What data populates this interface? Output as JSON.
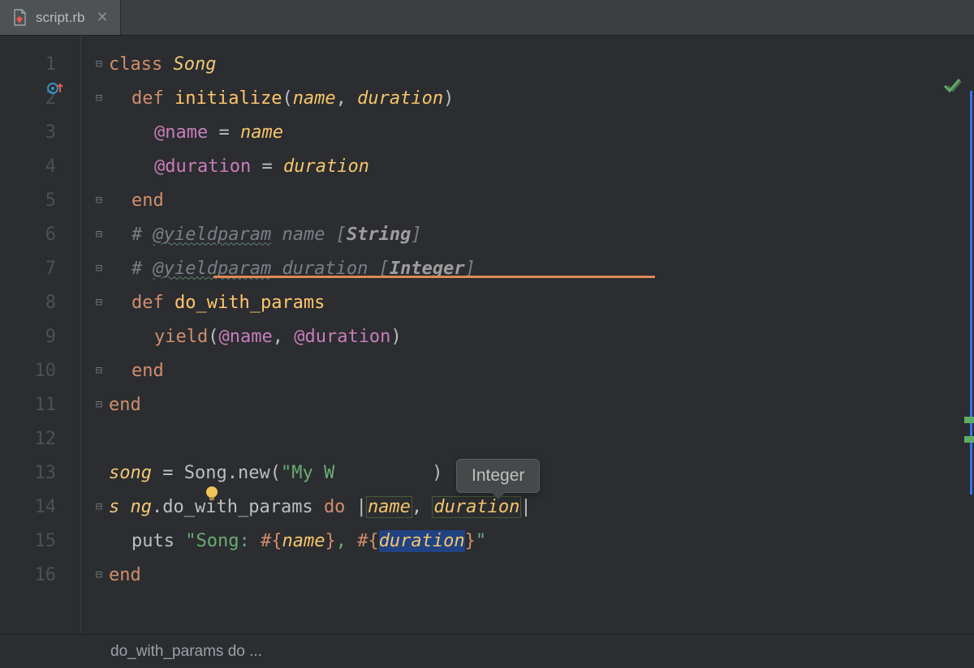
{
  "tab": {
    "filename": "script.rb"
  },
  "tooltip": {
    "text": "Integer"
  },
  "breadcrumb": {
    "text": "do_with_params do ..."
  },
  "gutter": [
    "1",
    "2",
    "3",
    "4",
    "5",
    "6",
    "7",
    "8",
    "9",
    "10",
    "11",
    "12",
    "13",
    "14",
    "15",
    "16"
  ],
  "code": {
    "l1": {
      "kw": "class ",
      "cls": "Song"
    },
    "l2": {
      "kw": "def ",
      "m": "initialize",
      "p1": "name",
      "c": ", ",
      "p2": "duration"
    },
    "l3": {
      "ivar": "@name",
      "op": " = ",
      "p": "name"
    },
    "l4": {
      "ivar": "@duration",
      "op": " = ",
      "p": "duration"
    },
    "l5": {
      "kw": "end"
    },
    "l6": {
      "h": "# ",
      "tag": "@yieldparam",
      "sp": " ",
      "n": "name",
      "br": " [",
      "t": "String",
      "br2": "]"
    },
    "l7": {
      "h": "# ",
      "tag": "@yieldparam",
      "sp": " ",
      "n": "duration",
      "br": " [",
      "t": "Integer",
      "br2": "]"
    },
    "l8": {
      "kw": "def ",
      "m": "do_with_params"
    },
    "l9": {
      "y": "yield",
      "o": "(",
      "v1": "@name",
      "c": ", ",
      "v2": "@duration",
      "cl": ")"
    },
    "l10": {
      "kw": "end"
    },
    "l11": {
      "kw": "end"
    },
    "l13": {
      "v": "song",
      "eq": " = ",
      "c": "Song",
      "d": ".",
      "m": "new",
      "o": "(",
      "s": "\"My W",
      "cl": ")"
    },
    "l14": {
      "v": "song",
      "d": ".",
      "m": "do_with_params ",
      "kw": "do",
      "b": " |",
      "p1": "name",
      "c": ", ",
      "p2": "duration",
      "b2": "|"
    },
    "l15": {
      "m": "puts ",
      "s1": "\"Song: ",
      "i1o": "#{",
      "i1": "name",
      "i1c": "}",
      "s2": ", ",
      "i2o": "#{",
      "i2": "duration",
      "i2c": "}",
      "s3": "\""
    },
    "l16": {
      "kw": "end"
    }
  }
}
